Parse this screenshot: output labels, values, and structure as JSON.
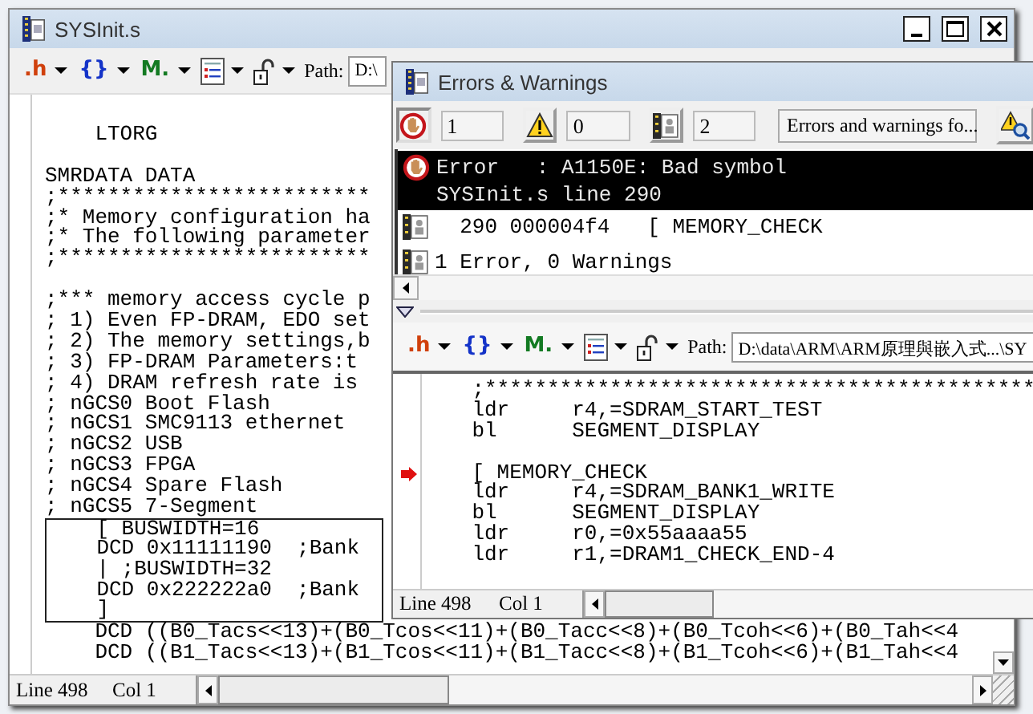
{
  "main_window": {
    "title": "SYSInit.s",
    "toolbar": {
      "items": [
        {
          "kind": "glyph",
          "text": ".h",
          "color": "#d0400c"
        },
        {
          "kind": "glyph",
          "text": "{}",
          "color": "#1433c8"
        },
        {
          "kind": "glyph",
          "text": "M.",
          "color": "#137a22"
        },
        {
          "kind": "document"
        },
        {
          "kind": "lock"
        }
      ],
      "path_label": "Path:",
      "path": "D:\\"
    },
    "code": [
      {
        "kind": "line",
        "text": "    LTORG"
      },
      {
        "kind": "blank"
      },
      {
        "kind": "line",
        "text": "SMRDATA DATA"
      },
      {
        "kind": "line",
        "text": ";*************************"
      },
      {
        "kind": "line",
        "text": ";* Memory configuration ha"
      },
      {
        "kind": "line",
        "text": ";* The following parameter"
      },
      {
        "kind": "line",
        "text": ";*************************"
      },
      {
        "kind": "blank"
      },
      {
        "kind": "line",
        "text": ";*** memory access cycle p"
      },
      {
        "kind": "line",
        "text": "; 1) Even FP-DRAM, EDO set"
      },
      {
        "kind": "line",
        "text": "; 2) The memory settings,b"
      },
      {
        "kind": "line",
        "text": "; 3) FP-DRAM Parameters:t"
      },
      {
        "kind": "line",
        "text": "; 4) DRAM refresh rate is"
      },
      {
        "kind": "line",
        "text": "; nGCS0 Boot Flash"
      },
      {
        "kind": "line",
        "text": "; nGCS1 SMC9113 ethernet"
      },
      {
        "kind": "line",
        "text": "; nGCS2 USB"
      },
      {
        "kind": "line",
        "text": "; nGCS3 FPGA"
      },
      {
        "kind": "line",
        "text": "; nGCS4 Spare Flash"
      },
      {
        "kind": "line",
        "text": "; nGCS5 7-Segment"
      },
      {
        "kind": "block",
        "lines": [
          "    [ BUSWIDTH=16",
          "    DCD 0x11111190  ;Bank",
          "    | ;BUSWIDTH=32",
          "    DCD 0x222222a0  ;Bank",
          "    ]"
        ]
      },
      {
        "kind": "line",
        "text": "    DCD ((B0_Tacs<<13)+(B0_Tcos<<11)+(B0_Tacc<<8)+(B0_Tcoh<<6)+(B0_Tah<<4"
      },
      {
        "kind": "line",
        "text": "    DCD ((B1_Tacs<<13)+(B1_Tcos<<11)+(B1_Tacc<<8)+(B1_Tcoh<<6)+(B1_Tah<<4"
      }
    ],
    "status_bar": {
      "line": "Line 498",
      "col": "Col 1"
    }
  },
  "errors_window": {
    "title": "Errors & Warnings",
    "counts": [
      {
        "kind": "error",
        "count": "1"
      },
      {
        "kind": "warning",
        "count": "0"
      },
      {
        "kind": "info",
        "count": "2"
      }
    ],
    "filter": "Errors and warnings fo...",
    "messages": [
      {
        "kind": "error",
        "selected": true,
        "lines": [
          "Error   : A1150E: Bad symbol",
          "SYSInit.s line 290"
        ]
      },
      {
        "kind": "info",
        "selected": false,
        "lines": [
          "  290 000004f4   [ MEMORY_CHECK"
        ]
      },
      {
        "kind": "info",
        "selected": false,
        "lines": [
          "1 Error, 0 Warnings"
        ]
      }
    ],
    "toolbar": {
      "items": [
        {
          "kind": "glyph",
          "text": ".h",
          "color": "#d0400c"
        },
        {
          "kind": "glyph",
          "text": "{}",
          "color": "#1433c8"
        },
        {
          "kind": "glyph",
          "text": "M.",
          "color": "#137a22"
        },
        {
          "kind": "document"
        },
        {
          "kind": "lock"
        }
      ],
      "path_label": "Path:",
      "path": "D:\\data\\ARM\\ARM原理與嵌入式...\\SY"
    },
    "code": [
      {
        "kind": "line",
        "text": "    ;********************************************"
      },
      {
        "kind": "line",
        "text": "    ldr     r4,=SDRAM_START_TEST"
      },
      {
        "kind": "line",
        "text": "    bl      SEGMENT_DISPLAY"
      },
      {
        "kind": "blank"
      },
      {
        "kind": "marker",
        "text": "    [ MEMORY_CHECK"
      },
      {
        "kind": "line",
        "text": "    ldr     r4,=SDRAM_BANK1_WRITE"
      },
      {
        "kind": "line",
        "text": "    bl      SEGMENT_DISPLAY"
      },
      {
        "kind": "line",
        "text": "    ldr     r0,=0x55aaaa55"
      },
      {
        "kind": "line",
        "text": "    ldr     r1,=DRAM1_CHECK_END-4"
      }
    ],
    "status_bar": {
      "line": "Line 498",
      "col": "Col 1"
    }
  }
}
